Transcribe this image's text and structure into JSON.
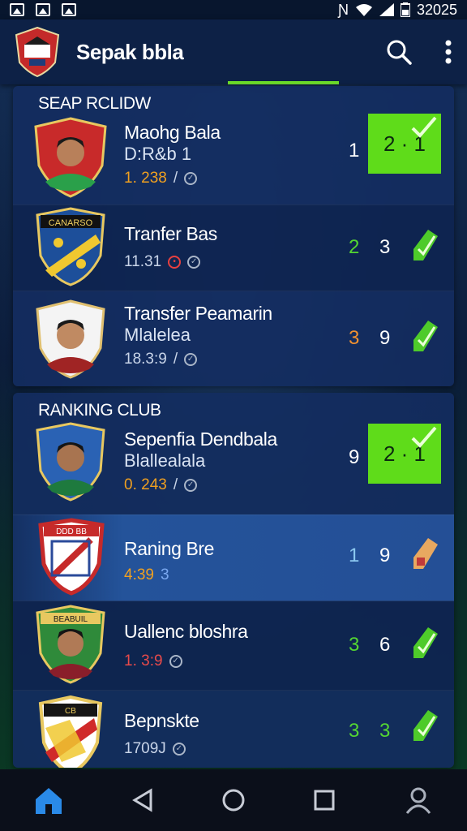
{
  "status": {
    "time": "32025"
  },
  "appbar": {
    "title": "Sepak bbla",
    "search_icon": "search-icon",
    "menu_icon": "more-vert-icon"
  },
  "colors": {
    "accent": "#5fdc1a",
    "panel": "#142d5f",
    "appbar": "#0d2146"
  },
  "section1": {
    "title": "SEAP RCLIDW",
    "rows": [
      {
        "name": "Maohg Bala",
        "sub": "D:R&b 1",
        "meta": "1. 238",
        "score_left": "1",
        "score_box": "2 · 1"
      },
      {
        "name": "Tranfer Bas",
        "sub": "",
        "meta": "11.31",
        "score_left": "2",
        "score_right": "3"
      },
      {
        "name": "Transfer Peamarin",
        "sub": "Mlalelea",
        "meta": "18.3:9",
        "score_left": "3",
        "score_right": "9"
      }
    ]
  },
  "section2": {
    "title": "RANKING CLUB",
    "rows": [
      {
        "name": "Sepenfia Dendbala",
        "sub": "Blallealala",
        "meta": "0. 243",
        "score_left": "9",
        "score_box": "2 · 1"
      },
      {
        "name": "Raning Bre",
        "sub": "",
        "meta": "4:39",
        "meta2": "3",
        "score_left": "1",
        "score_right": "9"
      },
      {
        "name": "Uallenc bloshra",
        "sub": "",
        "meta": "1. 3:9",
        "score_left": "3",
        "score_right": "6"
      },
      {
        "name": "Bepnskte",
        "sub": "",
        "meta": "1709J",
        "score_left": "3",
        "score_right": "3"
      }
    ]
  },
  "badges": {
    "row2_crest": "CANARSO",
    "row5_crest": "DDD BB",
    "row6_crest": "BEABUIL",
    "row7_crest": "CB"
  },
  "navbar": {
    "home": "home-icon",
    "back": "back-icon",
    "circle": "home-circle-icon",
    "recent": "recents-icon",
    "profile": "profile-icon"
  }
}
